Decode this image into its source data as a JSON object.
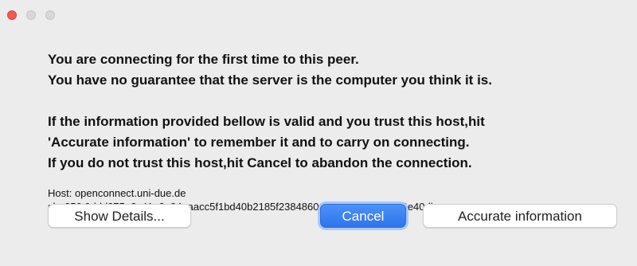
{
  "window": {
    "traffic_lights": [
      "close",
      "minimize",
      "zoom"
    ],
    "close_color": "#ee5c55",
    "inactive_color": "#d9d8d8"
  },
  "message": {
    "line1": "You are connecting for the first time to this peer.",
    "line2": "You have no guarantee that the server is the computer you think it is.",
    "line3": "If the information provided bellow is valid and you trust this host,hit",
    "line4": "'Accurate information' to remember it and to carry on connecting.",
    "line5": "If you do not trust this host,hit Cancel to abandon the connection."
  },
  "host": {
    "host_line": "Host: openconnect.uni-due.de",
    "hash_line": "sha256:0ddd275e2c41a2e84aaacc5f1bd40b2185f23848606f36ce49a21e1914e40dba"
  },
  "buttons": {
    "show_details": "Show Details...",
    "cancel": "Cancel",
    "accurate": "Accurate information"
  },
  "colors": {
    "accent": "#3b82f6",
    "background": "#ececec"
  }
}
